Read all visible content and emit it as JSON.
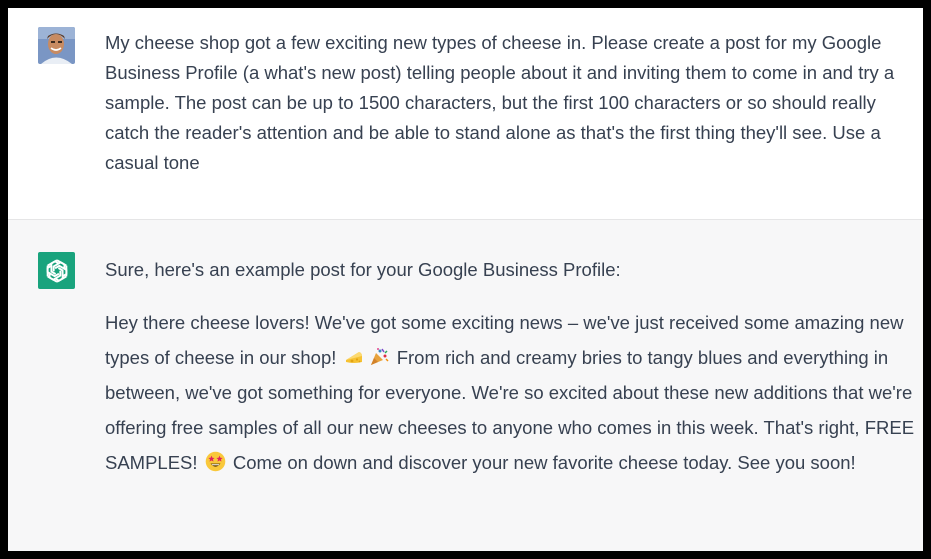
{
  "conversation": {
    "user": {
      "avatar_icon": "user-photo-avatar",
      "message": "My cheese shop got a few exciting new types of cheese in. Please create a post for my Google Business Profile (a what's new post) telling people about it and inviting them to come in and try a sample. The post can be up to 1500 characters, but the first 100 characters or so should really catch the reader's attention and be able to stand alone as that's the first thing they'll see.  Use a casual tone"
    },
    "assistant": {
      "avatar_icon": "chatgpt-logo-icon",
      "avatar_color": "#19a37d",
      "intro": "Sure, here's an example post for your Google Business Profile:",
      "post_part1": "Hey there cheese lovers! We've got some exciting news – we've just received some amazing new types of cheese in our shop!",
      "emoji_1": "cheese-emoji",
      "emoji_2": "party-popper-emoji",
      "post_part2": "From rich and creamy bries to tangy blues and everything in between, we've got something for everyone. We're so excited about these new additions that we're offering free samples of all our new cheeses to anyone who comes in this week. That's right, FREE SAMPLES!",
      "emoji_3": "star-struck-emoji",
      "post_part3": "Come on down and discover your new favorite cheese today. See you soon!"
    }
  },
  "colors": {
    "user_bg": "#ffffff",
    "assistant_bg": "#f7f7f8",
    "text": "#374151",
    "border": "#000000"
  }
}
